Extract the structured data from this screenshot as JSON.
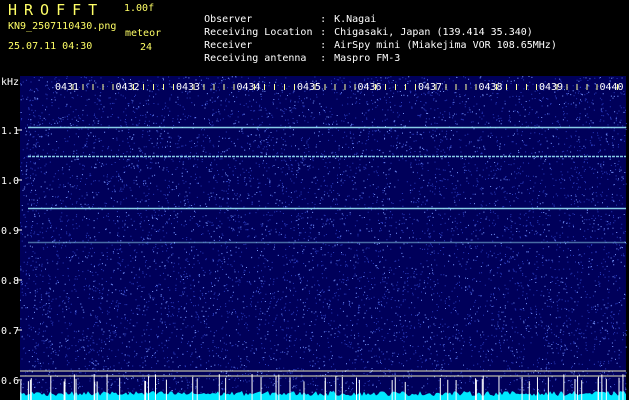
{
  "header": {
    "app_title": "HROFFT",
    "app_version": "1.00f",
    "filename": "KN9_2507110430.png",
    "datetime": "25.07.11 04:30",
    "meteor_label": "meteor",
    "meteor_count": "24",
    "info": [
      {
        "key": "Observer",
        "value": "K.Nagai"
      },
      {
        "key": "Receiving Location",
        "value": "Chigasaki, Japan (139.414 35.340)"
      },
      {
        "key": "Receiver",
        "value": "AirSpy mini (Miakejima VOR 108.65MHz)"
      },
      {
        "key": "Receiving antenna",
        "value": "Maspro FM-3"
      }
    ]
  },
  "plot": {
    "y_unit": "kHz",
    "y_range": [
      0.6,
      1.15
    ],
    "y_ticks": [
      "1.1",
      "1.0",
      "0.9",
      "0.8",
      "0.7",
      "0.6"
    ],
    "time_labels": [
      "0431",
      "0432",
      "0433",
      "0434",
      "0435",
      "0436",
      "0437",
      "0438",
      "0439",
      "0440"
    ],
    "carrier_lines_khz": [
      1.105,
      1.047,
      0.943,
      0.875
    ],
    "reference_lines_khz": [
      0.618,
      0.608
    ],
    "colors": {
      "background": "#00005a",
      "noise": "#3a50e0",
      "carrier": "#a0f0ff",
      "reference": "#ffffc0",
      "labels": "#ffffff",
      "floor": "#00e8ff"
    }
  }
}
